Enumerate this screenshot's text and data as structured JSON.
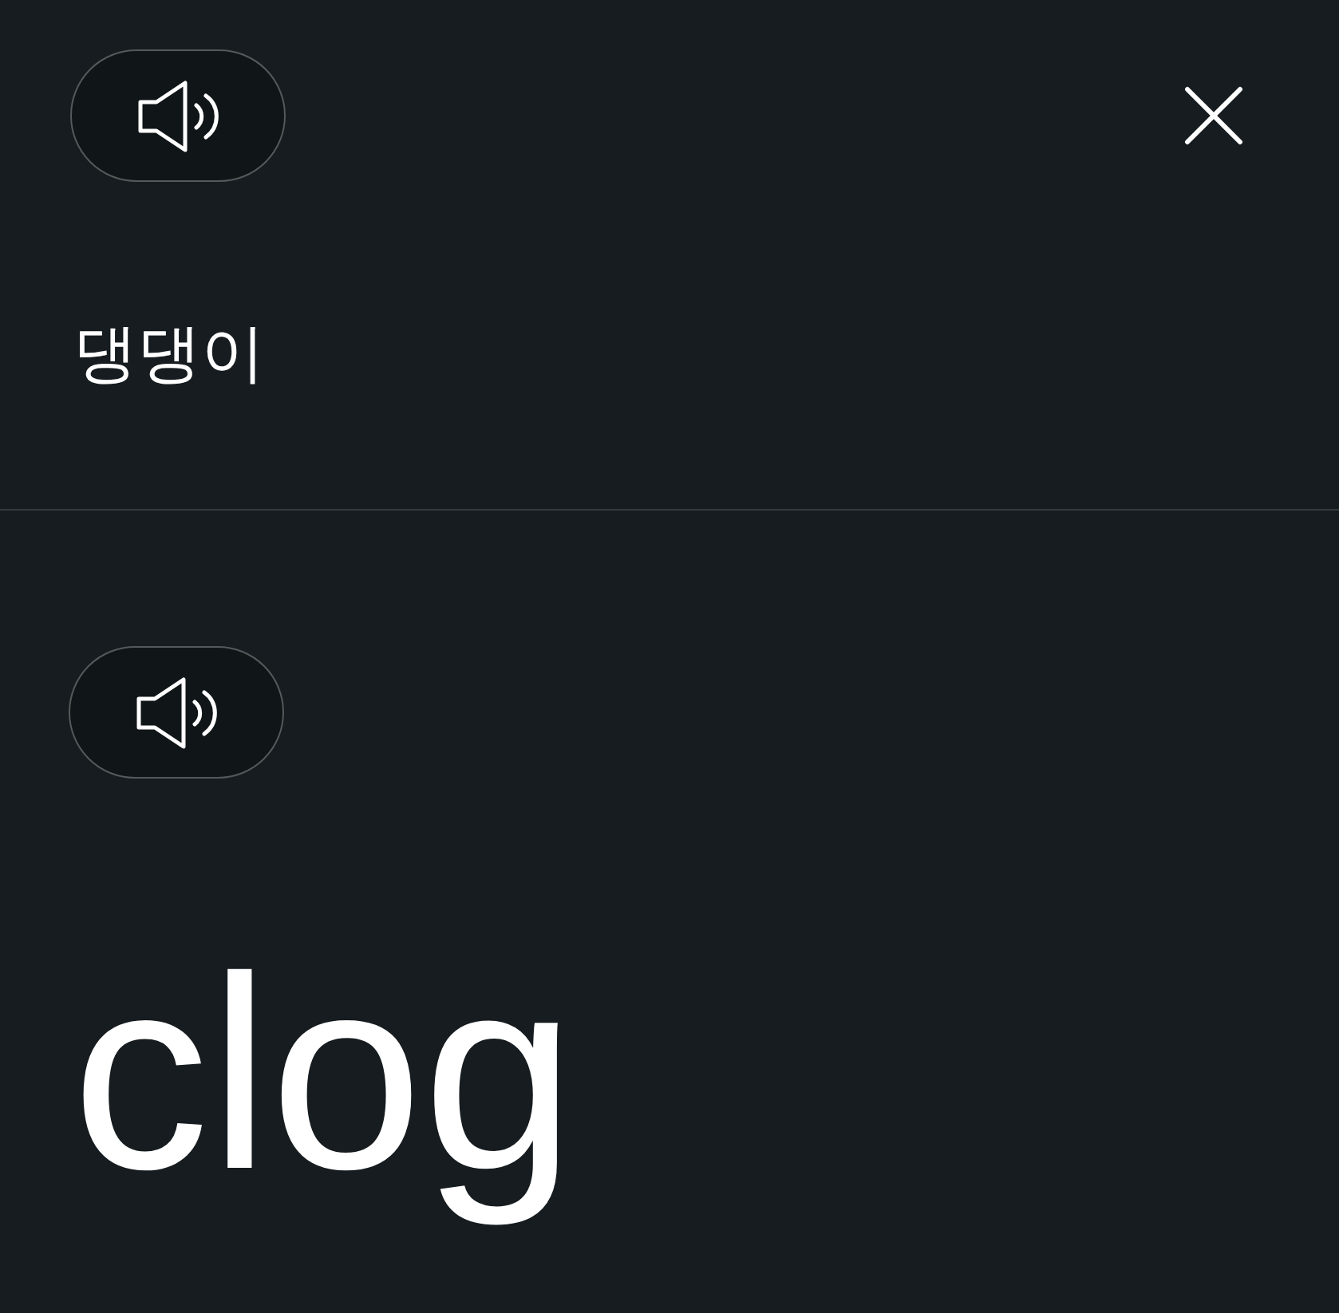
{
  "source": {
    "text": "댕댕이"
  },
  "translation": {
    "text": "clog"
  }
}
